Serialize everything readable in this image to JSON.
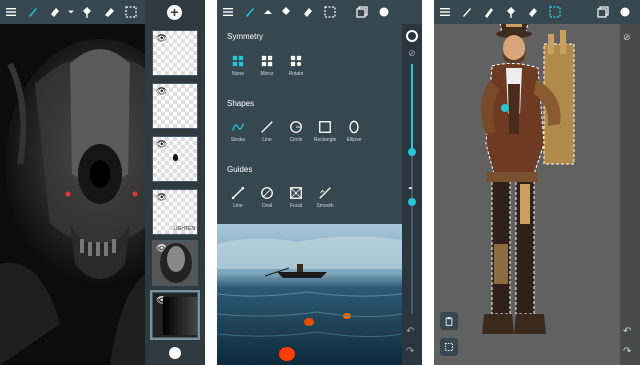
{
  "screen1": {
    "toolbar": {
      "icons": [
        "menu-icon",
        "brush-icon",
        "eraser-icon",
        "chevron-down-icon",
        "fill-icon",
        "smudge-icon",
        "selection-icon"
      ]
    },
    "layers_panel": {
      "add_label": "+",
      "layer_count": 6,
      "layer_text": "LIGHTEN"
    }
  },
  "screen2": {
    "symmetry": {
      "title": "Symmetry",
      "options": [
        "None",
        "Mirror",
        "Rotate"
      ]
    },
    "shapes": {
      "title": "Shapes",
      "options": [
        "Stroke",
        "Line",
        "Circle",
        "Rectangle",
        "Ellipse"
      ]
    },
    "guides": {
      "title": "Guides",
      "options": [
        "Line",
        "Oval",
        "Focal",
        "Smooth"
      ]
    },
    "brush_size": 0.35,
    "opacity": 0.55
  },
  "screen3": {
    "toolbar": {
      "icons": [
        "menu-icon",
        "brush-icon",
        "pen-icon",
        "fill-icon",
        "eraser-icon",
        "selection-icon",
        "layers-icon",
        "color-icon"
      ]
    }
  },
  "colors": {
    "toolbar": "#37474f",
    "accent": "#26c6da",
    "panel": "#37474f"
  }
}
